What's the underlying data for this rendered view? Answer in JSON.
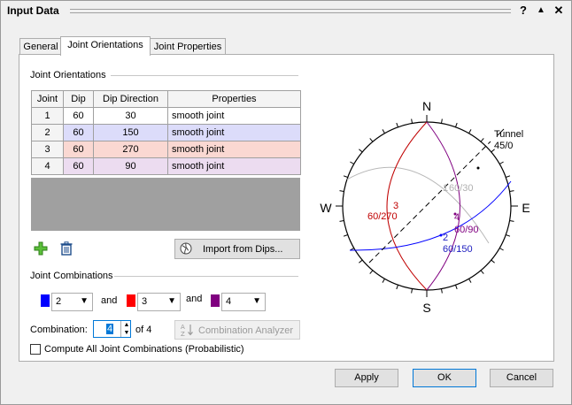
{
  "window": {
    "title": "Input Data",
    "help": "?",
    "collapse": "▲",
    "close": "✕"
  },
  "tabs": [
    {
      "label": "General"
    },
    {
      "label": "Joint Orientations"
    },
    {
      "label": "Joint Properties"
    }
  ],
  "orientations": {
    "group_label": "Joint Orientations",
    "headers": [
      "Joint",
      "Dip",
      "Dip Direction",
      "Properties"
    ],
    "rows": [
      {
        "joint": "1",
        "dip": "60",
        "dip_direction": "30",
        "properties": "smooth joint",
        "color": "#ffffff"
      },
      {
        "joint": "2",
        "dip": "60",
        "dip_direction": "150",
        "properties": "smooth joint",
        "color": "#dcdcfa"
      },
      {
        "joint": "3",
        "dip": "60",
        "dip_direction": "270",
        "properties": "smooth joint",
        "color": "#fad8d2"
      },
      {
        "joint": "4",
        "dip": "60",
        "dip_direction": "90",
        "properties": "smooth joint",
        "color": "#ecdcf0"
      }
    ],
    "add_icon": "plus-icon",
    "delete_icon": "trash-icon",
    "import_label": "Import from Dips..."
  },
  "combinations": {
    "group_label": "Joint Combinations",
    "and_label": "and",
    "selects": [
      {
        "value": "2",
        "color": "#0000ff"
      },
      {
        "value": "3",
        "color": "#ff0000"
      },
      {
        "value": "4",
        "color": "#800080"
      }
    ],
    "combination_label": "Combination:",
    "combination_value": "4",
    "of_label": "of 4",
    "analyzer_label": "Combination Analyzer",
    "checkbox_label": "Compute All Joint Combinations (Probabilistic)",
    "checkbox_checked": false
  },
  "stereonet": {
    "compass": {
      "n": "N",
      "s": "S",
      "e": "E",
      "w": "W"
    },
    "tunnel_label": "Tunnel",
    "tunnel_value": "45/0",
    "labels": [
      {
        "text": "3",
        "color": "#c00000"
      },
      {
        "text": "60/270",
        "color": "#c00000"
      },
      {
        "text": "1",
        "color": "#b0b0b0"
      },
      {
        "text": "60/30",
        "color": "#b0b0b0"
      },
      {
        "text": "4",
        "color": "#800080"
      },
      {
        "text": "60/90",
        "color": "#800080"
      },
      {
        "text": "2",
        "color": "#2020c0"
      },
      {
        "text": "60/150",
        "color": "#2020c0"
      }
    ]
  },
  "buttons": {
    "apply": "Apply",
    "ok": "OK",
    "cancel": "Cancel"
  }
}
